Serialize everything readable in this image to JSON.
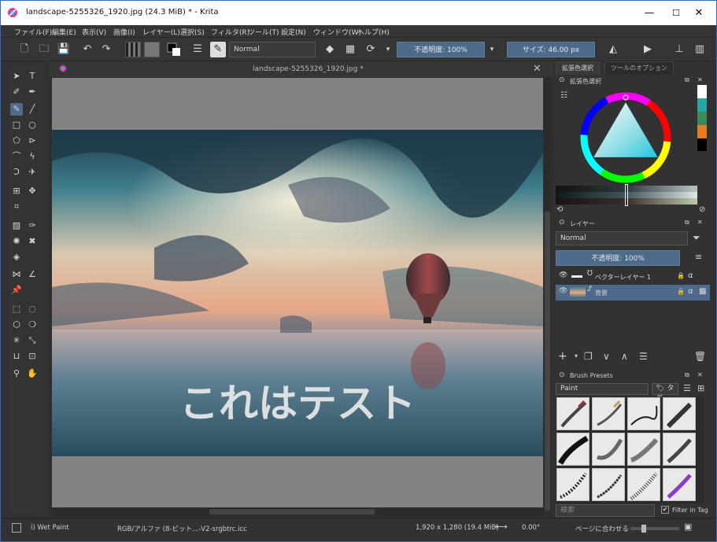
{
  "window": {
    "title": "landscape-5255326_1920.jpg (24.3 MiB)  * - Krita",
    "minimize": "—",
    "maximize": "☐",
    "close": "✕"
  },
  "menu": [
    "ファイル(F)",
    "編集(E)",
    "表示(V)",
    "画像(I)",
    "レイヤー(L)",
    "選択(S)",
    "フィルタ(R)",
    "ツール(T)",
    "設定(N)",
    "ウィンドウ(W)",
    "ヘルプ(H)"
  ],
  "toolbar": {
    "blend_mode": "Normal",
    "opacity": "不透明度: 100%",
    "size": "サイズ: 46.00 px"
  },
  "document": {
    "tab_title": "landscape-5255326_1920.jpg *",
    "overlay_text": "これはテスト"
  },
  "right_panel": {
    "tabs": [
      "拡張色選択",
      "ツールのオプション"
    ],
    "color_docker_title": "拡張色選択",
    "layers_title": "レイヤー",
    "layer_blend": "Normal",
    "layer_opacity": "不透明度: 100%",
    "layers": [
      {
        "name": "ベクターレイヤー 1"
      },
      {
        "name": "背景"
      }
    ],
    "brush_presets_title": "Brush Presets",
    "brush_filter": "Paint",
    "tag_label": "タグ",
    "search_placeholder": "検索",
    "filter_in_tag": "Filter in Tag"
  },
  "status": {
    "brush": "i) Wet Paint",
    "colorspace": "RGB/アルファ (8-ビット...-V2-srgbtrc.icc",
    "dimensions": "1,920 x 1,280 (19.4 MiB)",
    "rotation": "0.00°",
    "zoom_mode": "ページに合わせる"
  },
  "colors": {
    "accent": "#4d6a8a",
    "titlebar_border": "#2b6cc4",
    "swatches": [
      "#ffffff",
      "#2aa6a6",
      "#3a8a5a",
      "#e87a22",
      "#000000"
    ]
  }
}
